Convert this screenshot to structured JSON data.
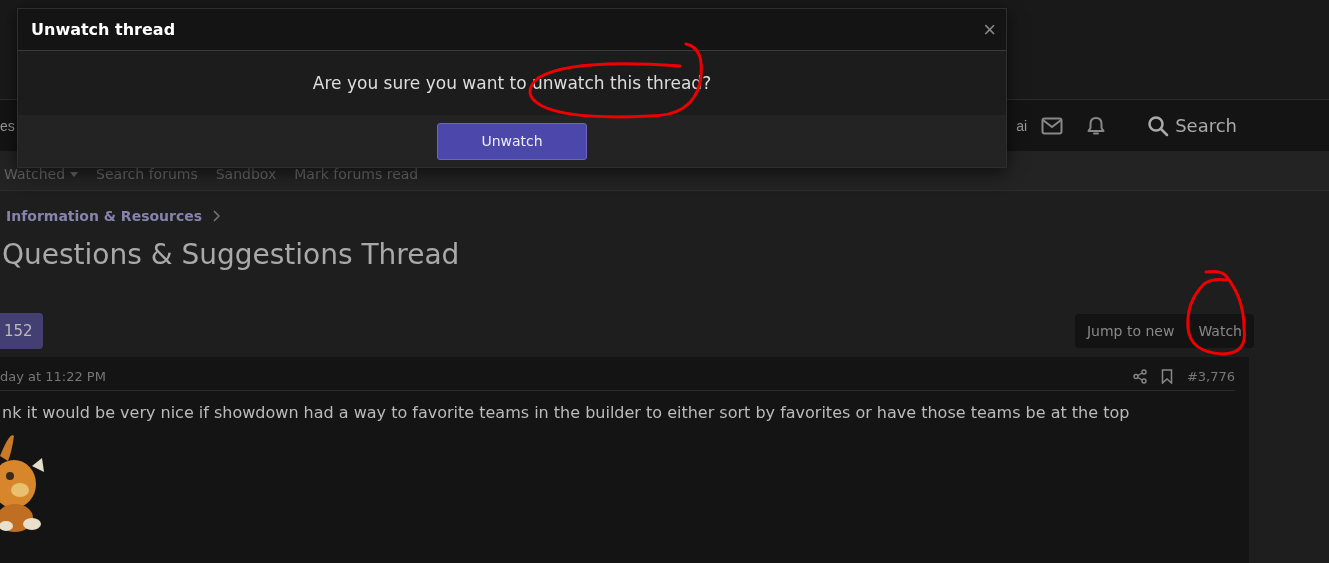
{
  "nav": {
    "left_fragment": "es",
    "right_fragment": "ai",
    "search_label": "Search"
  },
  "subnav": [
    {
      "label": "Watched",
      "has_caret": true
    },
    {
      "label": "Search forums",
      "has_caret": false
    },
    {
      "label": "Sandbox",
      "has_caret": false
    },
    {
      "label": "Mark forums read",
      "has_caret": false
    }
  ],
  "breadcrumb": "Information & Resources",
  "thread_title": "Questions & Suggestions Thread",
  "page_button": "152",
  "thread_actions": [
    "Jump to new",
    "Watch"
  ],
  "post": {
    "date": "day at 11:22 PM",
    "number": "#3,776",
    "body": "nk it would be very nice if showdown had a way to favorite teams in the builder to either sort by favorites or have those teams be at the top"
  },
  "dialog": {
    "title": "Unwatch thread",
    "close": "×",
    "message": "Are you sure you want to unwatch this thread?",
    "confirm": "Unwatch"
  }
}
